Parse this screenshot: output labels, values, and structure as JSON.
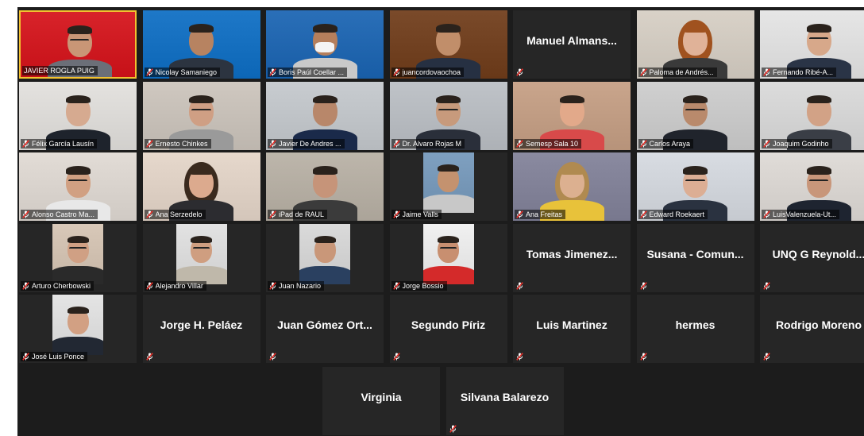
{
  "meeting": {
    "active_speaker_index": 0,
    "participants": [
      {
        "name": "JAVIER ROGLA PUIG",
        "video": true,
        "muted": false,
        "bg": "#d8232a",
        "skin": "#c99676",
        "shirt": "#6b6f78",
        "glasses": true
      },
      {
        "name": "Nicolay Samaniego",
        "video": true,
        "muted": true,
        "bg": "#1e78c8",
        "skin": "#b78361",
        "shirt": "#2c3440",
        "glasses": false
      },
      {
        "name": "Boris Paúl Coellar ...",
        "video": true,
        "muted": true,
        "bg": "#2a6fb8",
        "skin": "#b57f5c",
        "shirt": "#c9c9c9",
        "glasses": false,
        "mask": true
      },
      {
        "name": "juancordovaochoa",
        "video": true,
        "muted": true,
        "bg": "#7a4a2a",
        "skin": "#c18e6a",
        "shirt": "#263042",
        "glasses": false
      },
      {
        "name": "Manuel  Almans...",
        "video": false,
        "muted": true
      },
      {
        "name": "Paloma de Andrés...",
        "video": true,
        "muted": true,
        "bg": "#d9d2c8",
        "skin": "#e0b298",
        "shirt": "#3a3a3a",
        "glasses": false,
        "hair": "#a0521f"
      },
      {
        "name": "Fernando Ribé-A...",
        "video": true,
        "muted": true,
        "bg": "#e6e6e6",
        "skin": "#d7a88a",
        "shirt": "#2a3446",
        "glasses": true
      },
      {
        "name": "Félix García Lausín",
        "video": true,
        "muted": true,
        "bg": "#e4e2df",
        "skin": "#d6aa90",
        "shirt": "#1e232c",
        "glasses": false
      },
      {
        "name": "Ernesto Chinkes",
        "video": true,
        "muted": true,
        "bg": "#cfc8c0",
        "skin": "#cf9f84",
        "shirt": "#9a9a9a",
        "glasses": true
      },
      {
        "name": "Javier De Andres ...",
        "video": true,
        "muted": true,
        "bg": "#c8ccd0",
        "skin": "#b8876a",
        "shirt": "#1a2a4a",
        "glasses": false
      },
      {
        "name": "Dr. Alvaro Rojas M",
        "video": true,
        "muted": true,
        "bg": "#bfc3c8",
        "skin": "#c79a7c",
        "shirt": "#2a2f3a",
        "glasses": true
      },
      {
        "name": "Semesp Sala 10",
        "video": true,
        "muted": true,
        "bg": "#c9a58c",
        "skin": "#e2a98a",
        "shirt": "#d84a4a",
        "glasses": false
      },
      {
        "name": "Carlos Araya",
        "video": true,
        "muted": true,
        "bg": "#d0d0d0",
        "skin": "#b98a6c",
        "shirt": "#20242c",
        "glasses": true
      },
      {
        "name": "Joaquim Godinho",
        "video": true,
        "muted": true,
        "bg": "#dcdcdc",
        "skin": "#d2a286",
        "shirt": "#3a3e46",
        "glasses": false
      },
      {
        "name": "Alonso Castro Ma...",
        "video": true,
        "muted": true,
        "bg": "#e2dcd6",
        "skin": "#d1a082",
        "shirt": "#e8e8e8",
        "glasses": true
      },
      {
        "name": "Ana Serzedelo",
        "video": true,
        "muted": true,
        "bg": "#e6d8cc",
        "skin": "#dcaa8e",
        "shirt": "#2c2c30",
        "glasses": false,
        "hair": "#3a2a1e"
      },
      {
        "name": "iPad de RAUL",
        "video": true,
        "muted": true,
        "bg": "#bdb6ab",
        "skin": "#c69479",
        "shirt": "#3b3b3b",
        "glasses": false
      },
      {
        "name": "Jaime Valls",
        "video": true,
        "muted": true,
        "bg": "#7fa0c0",
        "skin": "#c4926f",
        "shirt": "#c8c8c8",
        "glasses": false,
        "boxed": true
      },
      {
        "name": "Ana Freitas",
        "video": true,
        "muted": true,
        "bg": "#8a8aa0",
        "skin": "#dcb090",
        "shirt": "#e8c23a",
        "glasses": false,
        "hair": "#b08a50"
      },
      {
        "name": "Edward Roekaert",
        "video": true,
        "muted": true,
        "bg": "#d8dce2",
        "skin": "#dcae94",
        "shirt": "#2a3240",
        "glasses": true
      },
      {
        "name": "LuisValenzuela-Ut...",
        "video": true,
        "muted": true,
        "bg": "#e0dcd8",
        "skin": "#c8967a",
        "shirt": "#1e2430",
        "glasses": true
      },
      {
        "name": "Arturo Cherbowski",
        "video": true,
        "muted": true,
        "bg": "#d8c8b8",
        "skin": "#d0a084",
        "shirt": "#2a2a2a",
        "glasses": true,
        "boxed": true
      },
      {
        "name": "Alejandro Villar",
        "video": true,
        "muted": true,
        "bg": "#e2e2e2",
        "skin": "#cf9e80",
        "shirt": "#bfb8aa",
        "glasses": true,
        "boxed": true
      },
      {
        "name": "Juan Nazario",
        "video": true,
        "muted": true,
        "bg": "#dadada",
        "skin": "#c99779",
        "shirt": "#2a4060",
        "glasses": false,
        "boxed": true
      },
      {
        "name": "Jorge Bossio",
        "video": true,
        "muted": true,
        "bg": "#f0f0f0",
        "skin": "#c88f70",
        "shirt": "#d42a2a",
        "glasses": true,
        "boxed": true
      },
      {
        "name": "Tomas  Jimenez...",
        "video": false,
        "muted": true
      },
      {
        "name": "Susana - Comun...",
        "video": false,
        "muted": true
      },
      {
        "name": "UNQ G Reynold...",
        "video": false,
        "muted": true
      },
      {
        "name": "José Luis Ponce",
        "video": true,
        "muted": true,
        "bg": "#e4e4e4",
        "skin": "#d2a083",
        "shirt": "#222833",
        "glasses": false,
        "boxed": true
      },
      {
        "name": "Jorge H. Peláez",
        "video": false,
        "muted": true
      },
      {
        "name": "Juan  Gómez  Ort...",
        "video": false,
        "muted": true
      },
      {
        "name": "Segundo  Píriz",
        "video": false,
        "muted": true
      },
      {
        "name": "Luis Martinez",
        "video": false,
        "muted": true
      },
      {
        "name": "hermes",
        "video": false,
        "muted": true
      },
      {
        "name": "Rodrigo Moreno",
        "video": false,
        "muted": true
      },
      {
        "name": "Virginia",
        "video": false,
        "muted": false
      },
      {
        "name": "Silvana Balarezo",
        "video": false,
        "muted": true
      }
    ]
  }
}
